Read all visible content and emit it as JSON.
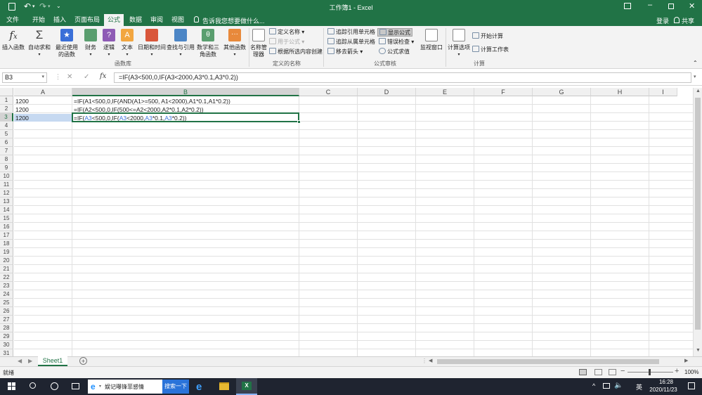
{
  "title": {
    "text": "工作簿1 - Excel",
    "qat_save": "H"
  },
  "account": {
    "login": "登录",
    "share": "共享"
  },
  "tabs": [
    "文件",
    "开始",
    "插入",
    "页面布局",
    "公式",
    "数据",
    "审阅",
    "视图"
  ],
  "tell_me": "告诉我您想要做什么...",
  "ribbon": {
    "function_library": {
      "label": "函数库",
      "buttons": [
        "插入函数",
        "自动求和",
        "最近使用的函数",
        "财务",
        "逻辑",
        "文本",
        "日期和时间",
        "查找与引用",
        "数学和三角函数",
        "其他函数"
      ]
    },
    "defined_names": {
      "label": "定义的名称",
      "name_manager": "名称管理器",
      "items": [
        "定义名称",
        "用于公式",
        "根据所选内容创建"
      ]
    },
    "formula_auditing": {
      "label": "公式审核",
      "items": [
        "追踪引用单元格",
        "追踪从属单元格",
        "移去箭头",
        "显示公式",
        "错误检查",
        "公式求值"
      ],
      "watch": "监视窗口"
    },
    "calculation": {
      "label": "计算",
      "options": "计算选项",
      "items": [
        "开始计算",
        "计算工作表"
      ]
    }
  },
  "formula_bar": {
    "name_box": "B3",
    "cancel": "✕",
    "enter": "✓",
    "fx": "fx",
    "formula": "=IF(A3<500,0,IF(A3<2000,A3*0.1,A3*0.2))"
  },
  "columns": [
    "A",
    "B",
    "C",
    "D",
    "E",
    "F",
    "G",
    "H",
    "I"
  ],
  "rows": [
    "1",
    "2",
    "3",
    "4",
    "5",
    "6",
    "7",
    "8",
    "9",
    "10",
    "11",
    "12",
    "13",
    "14",
    "15",
    "16",
    "17",
    "18",
    "19",
    "20",
    "21",
    "22",
    "23",
    "24",
    "25",
    "26",
    "27",
    "28",
    "29",
    "30",
    "31"
  ],
  "cells": {
    "A1": "1200",
    "A2": "1200",
    "A3": "1200",
    "B1": "=IF(A1<500,0,IF(AND(A1>=500, A1<2000),A1*0.1,A1*0.2))",
    "B2": "=IF(A2<500,0,IF(500<=A2<2000,A2*0.1,A2*0.2))",
    "B3_parts": [
      "=IF(",
      "A3",
      "<500,0,IF(",
      "A3",
      "<2000,",
      "A3",
      "*0.1,",
      "A3",
      "*0.2))"
    ]
  },
  "sheet_tab": "Sheet1",
  "status": {
    "ready": "就绪",
    "zoom": "100%"
  },
  "taskbar": {
    "browser_tab": "娱记曝锋菲感情",
    "search_btn": "搜索一下",
    "time": "16:28",
    "date": "2020/11/23",
    "ime": "英"
  },
  "colors": {
    "excel_green": "#217346",
    "ref_blue": "#3a6fd8",
    "selection": "#c6d9f1"
  }
}
